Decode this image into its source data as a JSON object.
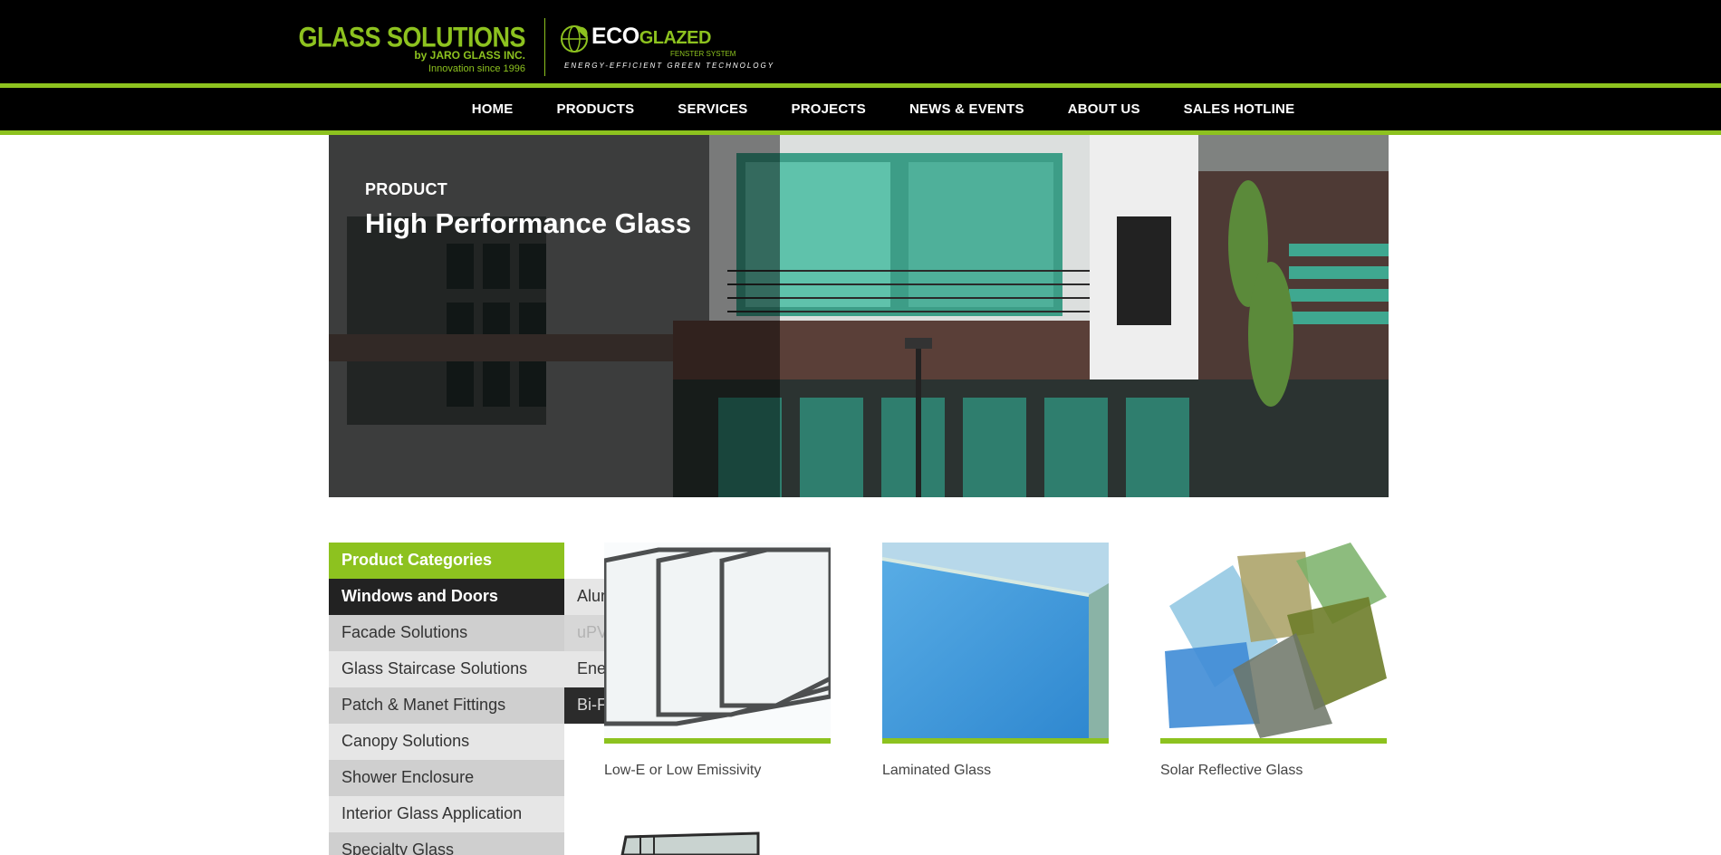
{
  "header": {
    "logo_glass_solutions": {
      "title": "GLASS SOLUTIONS",
      "sub": "by JARO GLASS INC.",
      "since": "Innovation since 1996"
    },
    "logo_eco": {
      "eco": "ECO",
      "glazed": "GLAZED",
      "fenster": "FENSTER SYSTEM",
      "tagline": "ENERGY-EFFICIENT GREEN TECHNOLOGY"
    }
  },
  "nav": {
    "items": [
      {
        "label": "HOME"
      },
      {
        "label": "PRODUCTS"
      },
      {
        "label": "SERVICES"
      },
      {
        "label": "PROJECTS"
      },
      {
        "label": "NEWS & EVENTS"
      },
      {
        "label": "ABOUT US"
      },
      {
        "label": "SALES HOTLINE"
      }
    ]
  },
  "hero": {
    "kicker": "PRODUCT",
    "title": "High Performance Glass"
  },
  "sidebar": {
    "heading": "Product Categories",
    "items": [
      {
        "label": "Windows and Doors"
      },
      {
        "label": "Facade Solutions"
      },
      {
        "label": "Glass Staircase Solutions"
      },
      {
        "label": "Patch & Manet Fittings"
      },
      {
        "label": "Canopy Solutions"
      },
      {
        "label": "Shower Enclosure"
      },
      {
        "label": "Interior Glass Application"
      },
      {
        "label": "Specialty Glass"
      }
    ]
  },
  "submenu": {
    "items": [
      {
        "label": "Aluminum Lear Profile Windows"
      },
      {
        "label": "uPVC Doors and Windows"
      },
      {
        "label": "Energy Saving Doors and Windows"
      },
      {
        "label": "Bi-Folding Doors"
      }
    ]
  },
  "products": [
    {
      "label": "Low-E or Low Emissivity"
    },
    {
      "label": "Laminated Glass"
    },
    {
      "label": "Solar Reflective Glass"
    }
  ],
  "colors": {
    "brand_green": "#8dc21f",
    "header_bg": "#000000"
  }
}
